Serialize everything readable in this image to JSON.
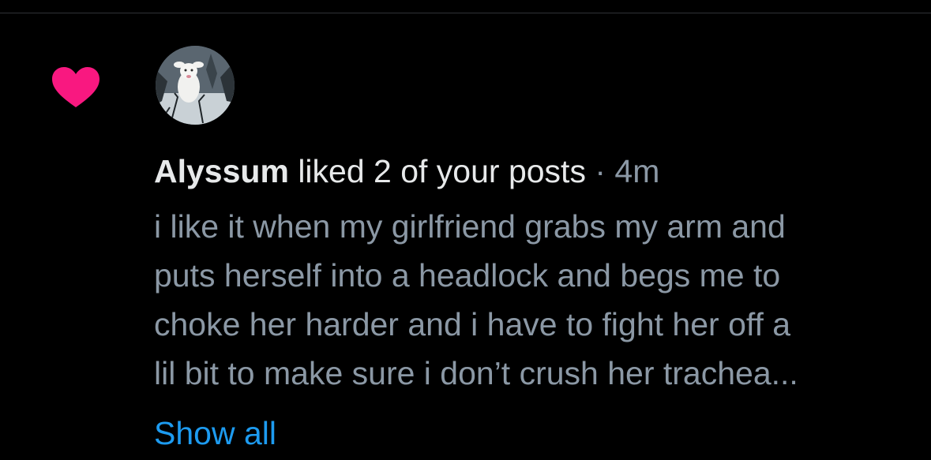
{
  "notification": {
    "icon": "heart-icon",
    "icon_color": "#f91880",
    "avatar": "avatar-white-deer-snow",
    "user_name": "Alyssum",
    "action_text": " liked 2 of your posts",
    "separator": " · ",
    "timestamp": "4m",
    "post_lines": [
      "i like it when my girlfriend grabs my arm and",
      "puts herself into a headlock and begs me to",
      "choke her harder and i have to fight her off a",
      "lil bit to make sure i don’t crush her trachea..."
    ],
    "show_all_label": "Show all"
  },
  "colors": {
    "background": "#000000",
    "primary_text": "#e7e9ea",
    "secondary_text": "#8b98a5",
    "link": "#1d9bf0",
    "divider": "#2f3336"
  }
}
